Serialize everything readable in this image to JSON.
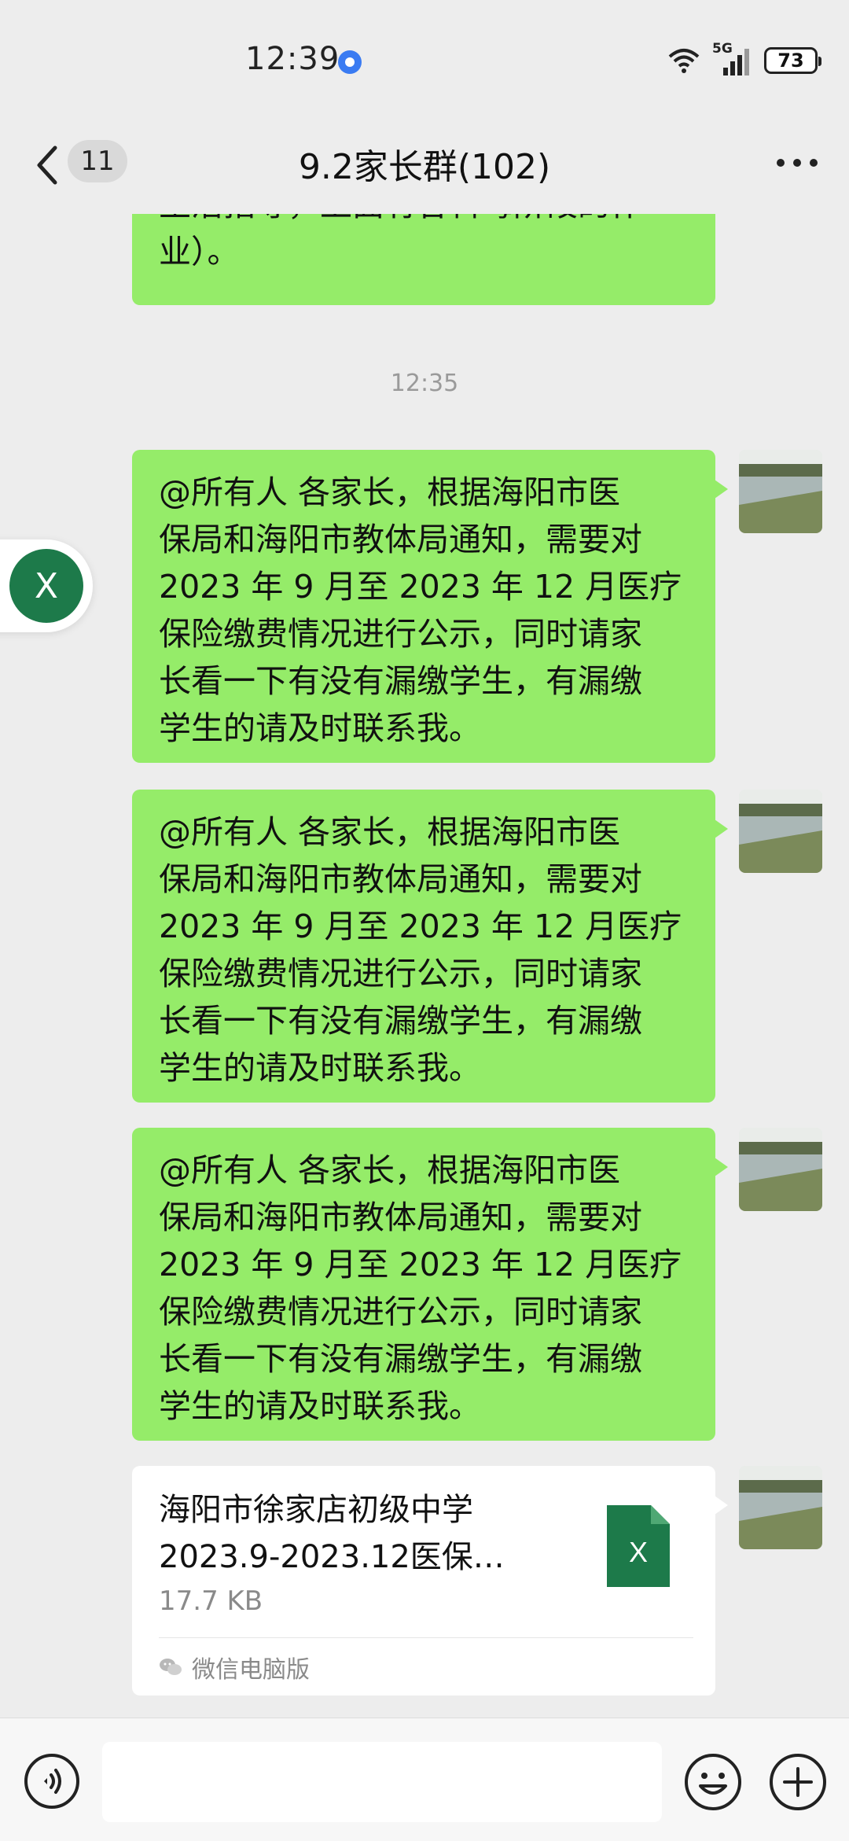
{
  "status": {
    "time": "12:39",
    "network": "5G",
    "battery": "73"
  },
  "nav": {
    "unread": "11",
    "title": "9.2家长群(102)"
  },
  "messages": {
    "partial": [
      "生活指导，上面有各科每阶段的作",
      "业）。"
    ],
    "timestamp": "12:35",
    "repeated": [
      [
        "@所有人  各家长，根据海阳市医",
        "保局和海阳市教体局通知，需要对",
        "2023 年 9 月至 2023 年 12 月医疗",
        "保险缴费情况进行公示，同时请家",
        "长看一下有没有漏缴学生，有漏缴",
        "学生的请及时联系我。"
      ],
      [
        "@所有人  各家长，根据海阳市医",
        "保局和海阳市教体局通知，需要对",
        "2023 年 9 月至 2023 年 12 月医疗",
        "保险缴费情况进行公示，同时请家",
        "长看一下有没有漏缴学生，有漏缴",
        "学生的请及时联系我。"
      ],
      [
        "@所有人  各家长，根据海阳市医",
        "保局和海阳市教体局通知，需要对",
        "2023 年 9 月至 2023 年 12 月医疗",
        "保险缴费情况进行公示，同时请家",
        "长看一下有没有漏缴学生，有漏缴",
        "学生的请及时联系我。"
      ]
    ]
  },
  "file": {
    "name_line1": "海阳市徐家店初级中学",
    "name_line2": "2023.9-2023.12医保…",
    "size": "17.7 KB",
    "icon_letter": "X",
    "source": "微信电脑版"
  },
  "floating": {
    "letter": "X"
  },
  "icons": [
    "back-icon",
    "more-icon",
    "voice-icon",
    "emoji-icon",
    "plus-icon",
    "excel-file-icon",
    "wechat-icon",
    "wifi-icon",
    "signal-icon"
  ],
  "colors": {
    "bubble": "#95ec69",
    "background": "#ededed",
    "excel": "#1d7a4a"
  }
}
